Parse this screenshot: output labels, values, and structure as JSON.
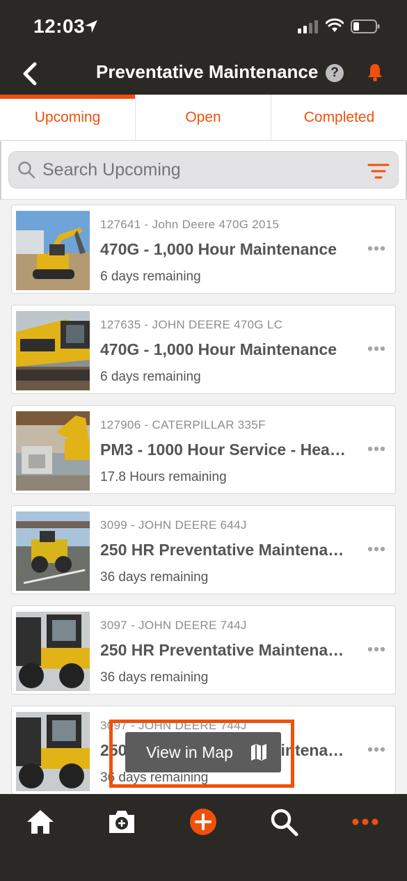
{
  "status_bar": {
    "time": "12:03"
  },
  "nav": {
    "title": "Preventative Maintenance",
    "help_glyph": "?"
  },
  "tabs": [
    {
      "label": "Upcoming",
      "active": true
    },
    {
      "label": "Open",
      "active": false
    },
    {
      "label": "Completed",
      "active": false
    }
  ],
  "search": {
    "placeholder": "Search Upcoming",
    "value": ""
  },
  "items": [
    {
      "asset": "127641 - John Deere 470G 2015",
      "title": "470G - 1,000 Hour Maintenance",
      "remaining": "6 days remaining"
    },
    {
      "asset": "127635 - JOHN DEERE 470G LC",
      "title": "470G - 1,000 Hour Maintenance",
      "remaining": "6 days remaining"
    },
    {
      "asset": "127906 - CATERPILLAR 335F",
      "title": "PM3 - 1000 Hour Service - Hea…",
      "remaining": "17.8 Hours remaining"
    },
    {
      "asset": "3099 - JOHN DEERE 644J",
      "title": "250 HR Preventative Maintena…",
      "remaining": "36 days remaining"
    },
    {
      "asset": "3097 - JOHN DEERE 744J",
      "title": "250 HR Preventative Maintena…",
      "remaining": "36 days remaining"
    },
    {
      "asset": "3097 - JOHN DEERE 744J",
      "title": "250 HR Preventative Maintena…",
      "remaining": "36 days remaining"
    }
  ],
  "map_button": {
    "label": "View in Map"
  },
  "tabbar": [
    "home-icon",
    "camera-icon",
    "add-icon",
    "search-icon",
    "more-icon"
  ],
  "colors": {
    "accent": "#f0500c",
    "dark": "#2b2926",
    "text": "#555555"
  }
}
